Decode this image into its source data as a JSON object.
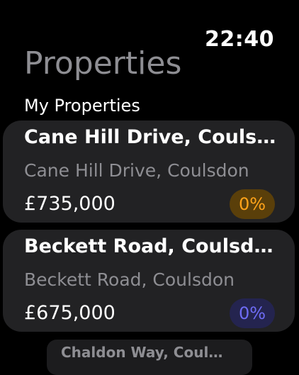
{
  "status": {
    "time": "22:40"
  },
  "page": {
    "title": "Properties"
  },
  "section": {
    "title": "My Properties"
  },
  "properties": [
    {
      "title": "Cane Hill Drive, Coulsdon",
      "subtitle": "Cane Hill Drive, Coulsdon",
      "price": "£735,000",
      "change": "0%",
      "badge_color": "#ffa31a"
    },
    {
      "title": "Beckett Road, Coulsdon",
      "subtitle": "Beckett Road, Coulsdon",
      "price": "£675,000",
      "change": "0%",
      "badge_color": "#6e6cf5"
    },
    {
      "title": "Chaldon Way, Coulsdon"
    }
  ]
}
